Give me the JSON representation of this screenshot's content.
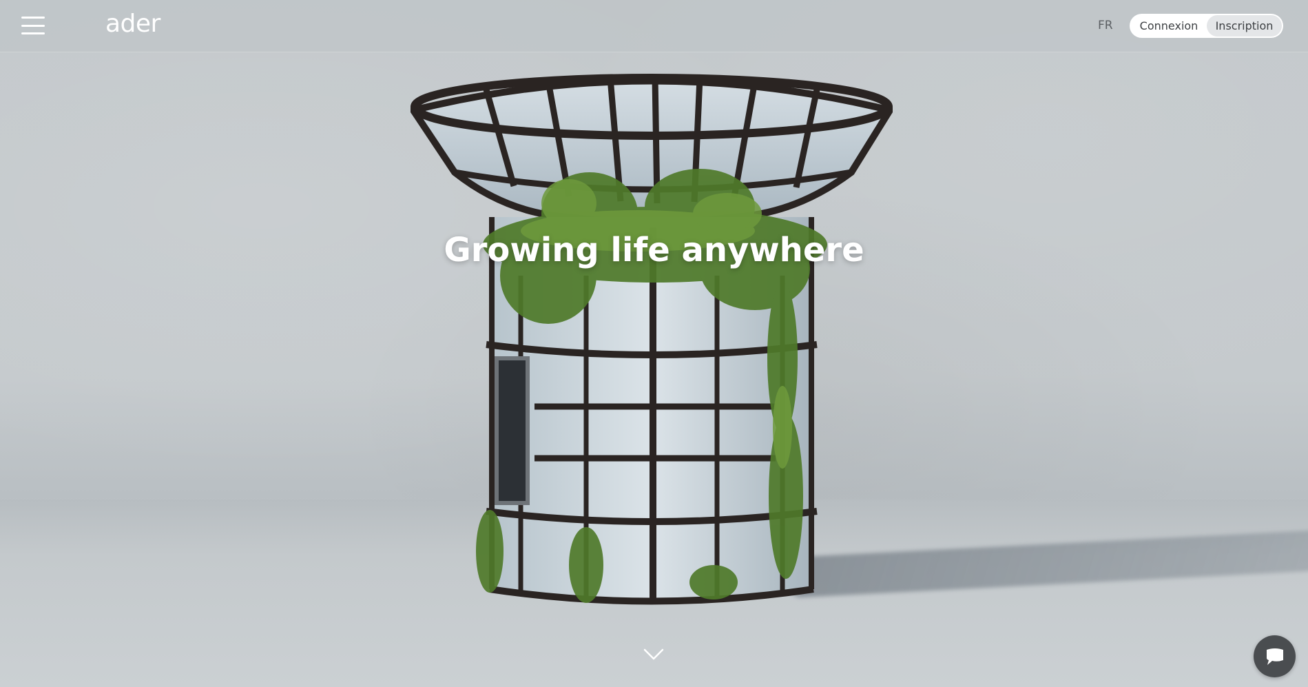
{
  "header": {
    "menu_icon": "hamburger-menu-icon",
    "logo": "ader",
    "language": "FR",
    "login_label": "Connexion",
    "signup_label": "Inscription"
  },
  "hero": {
    "headline": "Growing life anywhere",
    "scroll_icon": "chevron-down-icon"
  },
  "chat": {
    "icon": "chat-bubble-icon"
  },
  "colors": {
    "header_text": "#ffffff",
    "button_bg": "#ffffff",
    "button_active_bg": "#e4e6e8",
    "chat_bg": "#4a4d50"
  }
}
